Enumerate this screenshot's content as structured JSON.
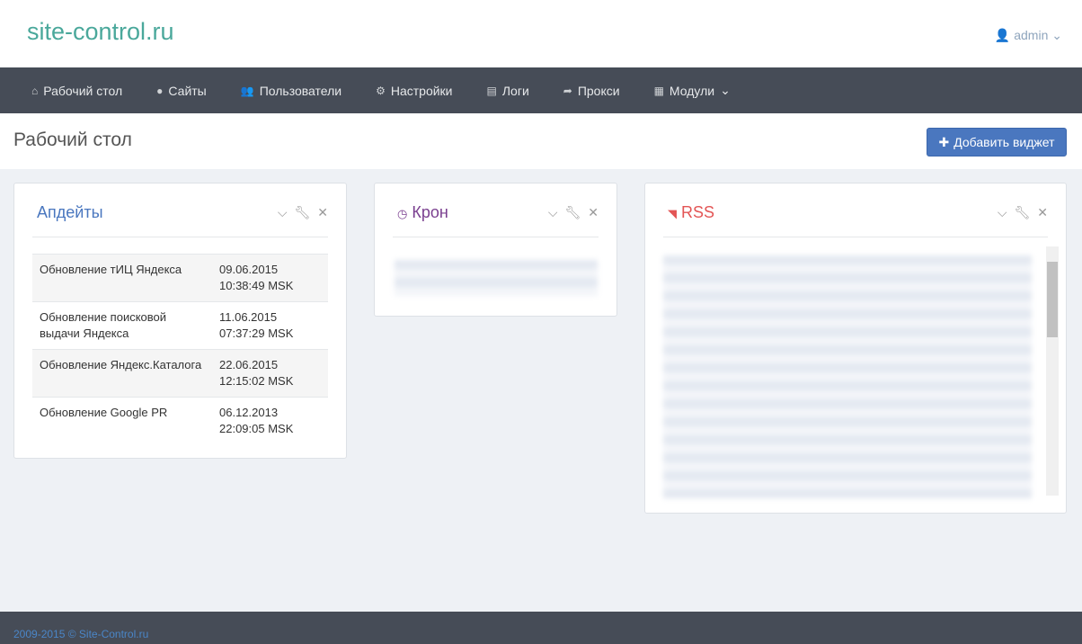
{
  "header": {
    "logo": "site-control.ru",
    "user": "admin"
  },
  "nav": [
    {
      "icon": "home-icon",
      "glyph": "⌂",
      "label": "Рабочий стол"
    },
    {
      "icon": "globe-icon",
      "glyph": "●",
      "label": "Сайты"
    },
    {
      "icon": "users-icon",
      "glyph": "👥",
      "label": "Пользователи"
    },
    {
      "icon": "gear-icon",
      "glyph": "⚙",
      "label": "Настройки"
    },
    {
      "icon": "file-icon",
      "glyph": "▤",
      "label": "Логи"
    },
    {
      "icon": "share-icon",
      "glyph": "➦",
      "label": "Прокси"
    },
    {
      "icon": "grid-icon",
      "glyph": "▦",
      "label": "Модули"
    }
  ],
  "page": {
    "title": "Рабочий стол",
    "add_widget": "Добавить виджет"
  },
  "widgets": {
    "updates": {
      "title": "Апдейты",
      "rows": [
        {
          "name": "Обновление тИЦ Яндекса",
          "date": "09.06.2015",
          "time": "10:38:49 MSK"
        },
        {
          "name": "Обновление поисковой выдачи Яндекса",
          "date": "11.06.2015",
          "time": "07:37:29 MSK"
        },
        {
          "name": "Обновление Яндекс.Каталога",
          "date": "22.06.2015",
          "time": "12:15:02 MSK"
        },
        {
          "name": "Обновление Google PR",
          "date": "06.12.2013",
          "time": "22:09:05 MSK"
        }
      ]
    },
    "cron": {
      "title": "Крон"
    },
    "rss": {
      "title": "RSS"
    }
  },
  "colors": {
    "updates": "#4a77bf",
    "cron": "#7a3f8f",
    "rss": "#e35555"
  },
  "footer": "2009-2015 © Site-Control.ru"
}
